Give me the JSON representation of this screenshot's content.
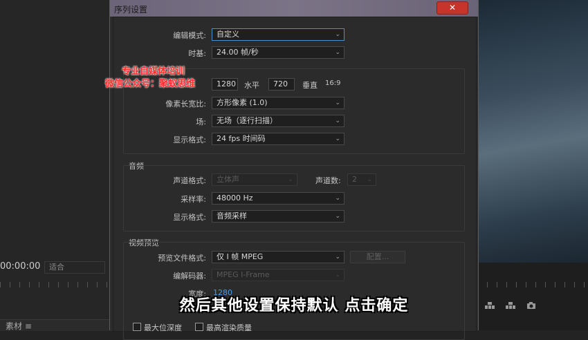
{
  "background": {
    "timecode": "00:00:00",
    "fit_select": "适合",
    "bottom_tab": "素材    ≡"
  },
  "dialog": {
    "title": "序列设置",
    "close_icon": "✕",
    "editing_mode": {
      "label": "编辑模式:",
      "value": "自定义"
    },
    "timebase": {
      "label": "时基:",
      "value": "24.00  帧/秒"
    },
    "frame_size": {
      "width": "1280",
      "h_label": "水平",
      "height": "720",
      "v_label": "垂直",
      "aspect": "16:9"
    },
    "pixel_aspect": {
      "label": "像素长宽比:",
      "value": "方形像素 (1.0)"
    },
    "fields": {
      "label": "场:",
      "value": "无场（逐行扫描）"
    },
    "display_format": {
      "label": "显示格式:",
      "value": "24 fps 时间码"
    },
    "audio": {
      "title": "音频",
      "channel_format": {
        "label": "声道格式:",
        "value": "立体声"
      },
      "channels": {
        "label": "声道数:",
        "value": "2"
      },
      "sample_rate": {
        "label": "采样率:",
        "value": "48000 Hz"
      },
      "display_format": {
        "label": "显示格式:",
        "value": "音频采样"
      }
    },
    "video_preview": {
      "title": "视频预览",
      "file_format": {
        "label": "预览文件格式:",
        "value": "仅 I 帧 MPEG"
      },
      "configure_button": "配置...",
      "codec": {
        "label": "编解码器:",
        "value": "MPEG I-Frame"
      },
      "width": {
        "label": "宽度:",
        "value": "1280"
      }
    },
    "checkboxes": {
      "max_bit_depth": "最大位深度",
      "max_render_quality": "最高渲染质量"
    }
  },
  "overlay": {
    "watermark_line1": "专业自媒体培训",
    "watermark_line2": "微信公众号：聚蚁思维",
    "subtitle": "然后其他设置保持默认 点击确定"
  }
}
